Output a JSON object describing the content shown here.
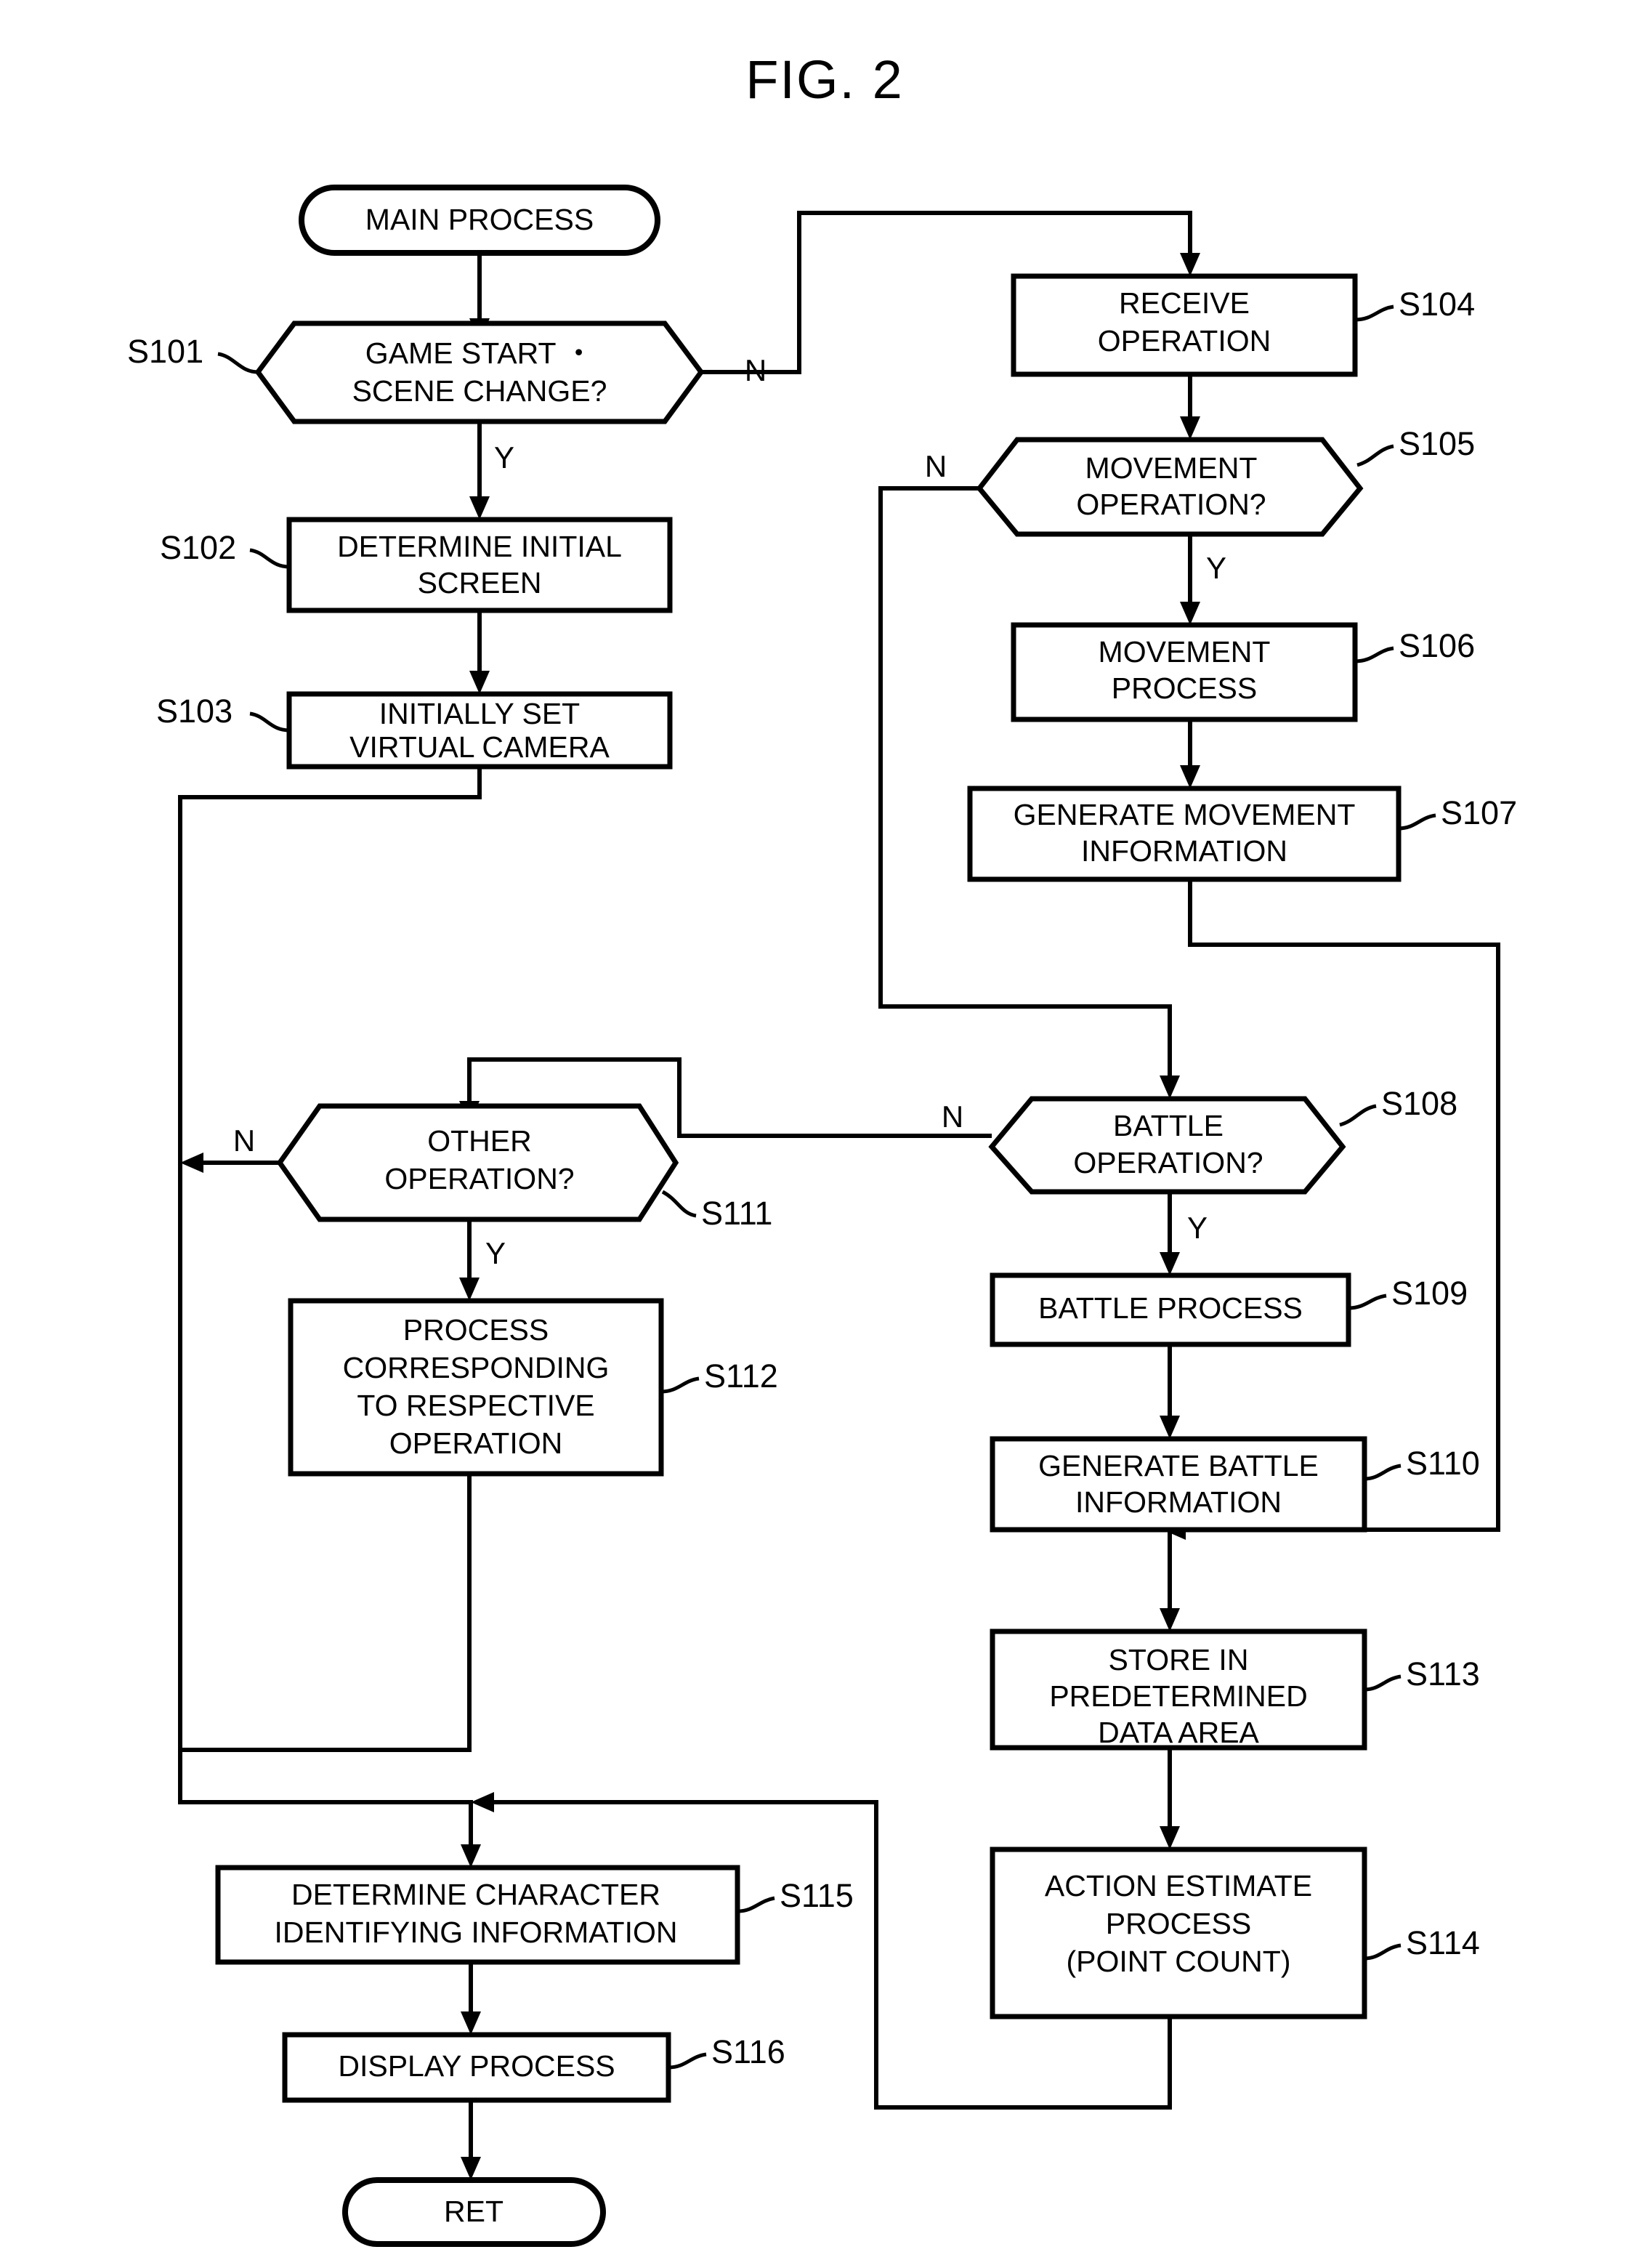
{
  "figure": {
    "title": "FIG. 2",
    "type": "patent-flowchart"
  },
  "nodes": {
    "start": {
      "id": "start",
      "shape": "terminator",
      "label": "MAIN PROCESS"
    },
    "s101": {
      "id": "S101",
      "shape": "decision",
      "line1": "GAME START ・",
      "line2": "SCENE CHANGE?",
      "step": "S101"
    },
    "s102": {
      "id": "S102",
      "shape": "process",
      "line1": "DETERMINE INITIAL",
      "line2": "SCREEN",
      "step": "S102"
    },
    "s103": {
      "id": "S103",
      "shape": "process",
      "line1": "INITIALLY SET",
      "line2": "VIRTUAL CAMERA",
      "step": "S103"
    },
    "s104": {
      "id": "S104",
      "shape": "process",
      "line1": "RECEIVE",
      "line2": "OPERATION",
      "step": "S104"
    },
    "s105": {
      "id": "S105",
      "shape": "decision",
      "line1": "MOVEMENT",
      "line2": "OPERATION?",
      "step": "S105"
    },
    "s106": {
      "id": "S106",
      "shape": "process",
      "line1": "MOVEMENT",
      "line2": "PROCESS",
      "step": "S106"
    },
    "s107": {
      "id": "S107",
      "shape": "process",
      "line1": "GENERATE MOVEMENT",
      "line2": "INFORMATION",
      "step": "S107"
    },
    "s108": {
      "id": "S108",
      "shape": "decision",
      "line1": "BATTLE",
      "line2": "OPERATION?",
      "step": "S108"
    },
    "s109": {
      "id": "S109",
      "shape": "process",
      "line1": "BATTLE PROCESS",
      "line2": "",
      "step": "S109"
    },
    "s110": {
      "id": "S110",
      "shape": "process",
      "line1": "GENERATE BATTLE",
      "line2": "INFORMATION",
      "step": "S110"
    },
    "s111": {
      "id": "S111",
      "shape": "decision",
      "line1": "OTHER",
      "line2": "OPERATION?",
      "step": "S111"
    },
    "s112": {
      "id": "S112",
      "shape": "process",
      "line1": "PROCESS",
      "line2": "CORRESPONDING",
      "line3": "TO RESPECTIVE",
      "line4": "OPERATION",
      "step": "S112"
    },
    "s113": {
      "id": "S113",
      "shape": "process",
      "line1": "STORE IN",
      "line2": "PREDETERMINED",
      "line3": "DATA AREA",
      "step": "S113"
    },
    "s114": {
      "id": "S114",
      "shape": "process",
      "line1": "ACTION ESTIMATE",
      "line2": "PROCESS",
      "line3": "(POINT COUNT)",
      "step": "S114"
    },
    "s115": {
      "id": "S115",
      "shape": "process",
      "line1": "DETERMINE CHARACTER",
      "line2": "IDENTIFYING INFORMATION",
      "step": "S115"
    },
    "s116": {
      "id": "S116",
      "shape": "process",
      "line1": "DISPLAY PROCESS",
      "line2": "",
      "step": "S116"
    },
    "ret": {
      "id": "ret",
      "shape": "terminator",
      "label": "RET"
    }
  },
  "branch_labels": {
    "s101_no": "N",
    "s101_yes": "Y",
    "s105_no": "N",
    "s105_yes": "Y",
    "s108_no": "N",
    "s108_yes": "Y",
    "s111_no": "N",
    "s111_yes": "Y"
  },
  "colors": {
    "stroke": "#000000",
    "fill": "#ffffff",
    "background": "#ffffff"
  }
}
